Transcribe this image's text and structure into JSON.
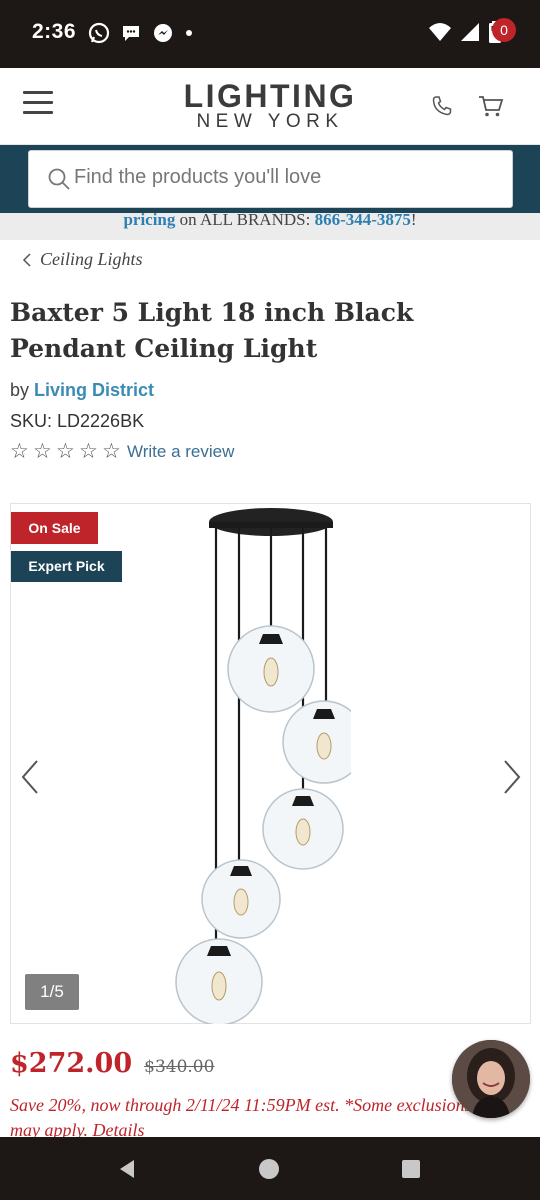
{
  "status_bar": {
    "time": "2:36"
  },
  "header": {
    "logo_line1": "LIGHTING",
    "logo_line2": "NEW YORK",
    "cart_count": "0"
  },
  "search": {
    "placeholder": "Find the products you'll love"
  },
  "promo": {
    "link_text": "pricing",
    "middle_text": " on ALL BRANDS: ",
    "phone": "866-344-3875",
    "end_text": "!"
  },
  "breadcrumb": {
    "label": "Ceiling Lights"
  },
  "product": {
    "title": "Baxter 5 Light 18 inch Black Pendant Ceiling Light",
    "by_label": "by ",
    "brand": "Living District",
    "sku_label": "SKU: ",
    "sku": "LD2226BK",
    "rating_stars": 0,
    "review_link": "Write a review"
  },
  "gallery": {
    "badge_sale": "On Sale",
    "badge_expert": "Expert Pick",
    "counter": "1/5"
  },
  "pricing": {
    "price": "$272.00",
    "old_price": "$340.00",
    "note_line1": "Save 20%, now through 2/11/24 11:59PM est. *Some exclusions",
    "note_line2": "may apply. ",
    "details_link": "Details"
  },
  "colors": {
    "brand_navy": "#1d4356",
    "sale_red": "#c0242b",
    "link_blue": "#3b8bb5"
  },
  "icons": {
    "status_left": [
      "whatsapp-icon",
      "chat-bubble-icon",
      "messenger-icon",
      "dot-icon"
    ],
    "status_right": [
      "wifi-icon",
      "signal-icon",
      "battery-icon"
    ]
  }
}
